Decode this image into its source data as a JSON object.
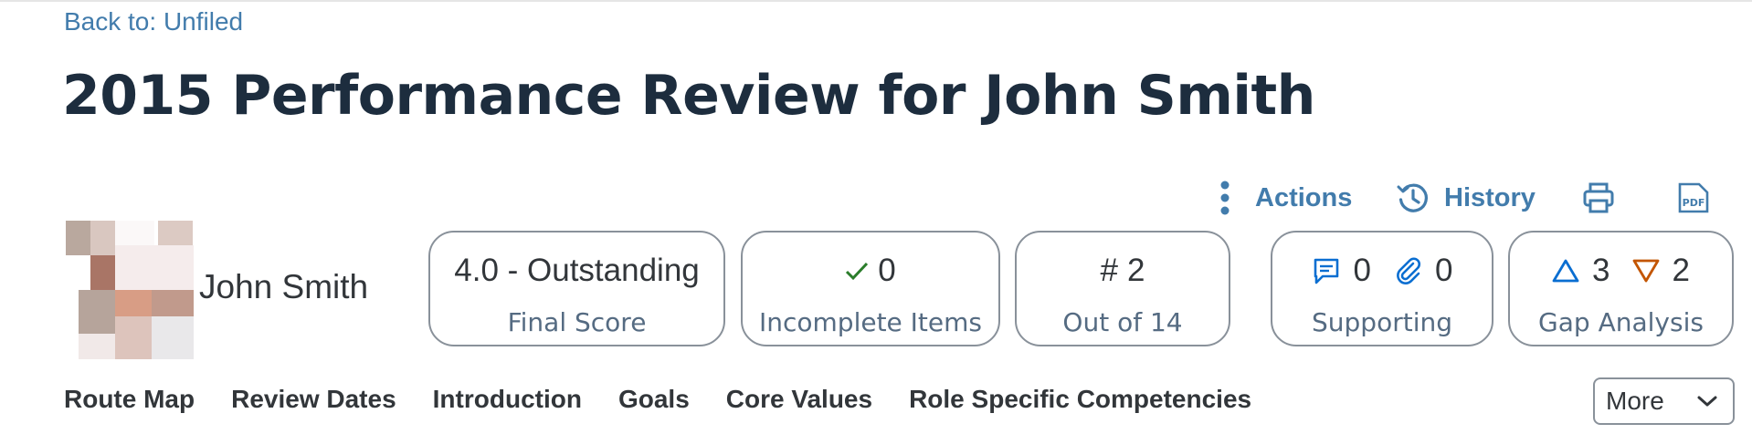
{
  "nav": {
    "back_link": "Back to: Unfiled"
  },
  "page": {
    "title": "2015 Performance Review for John Smith"
  },
  "actions": {
    "actions_label": "Actions",
    "history_label": "History",
    "print_icon": "printer-icon",
    "pdf_icon": "pdf-icon"
  },
  "user": {
    "name": "John Smith"
  },
  "cards": {
    "final_score": {
      "value": "4.0 - Outstanding",
      "label": "Final Score"
    },
    "incomplete": {
      "value": "0",
      "label": "Incomplete Items"
    },
    "rank": {
      "prefix": "#",
      "value": "2",
      "label": "Out of 14"
    },
    "supporting": {
      "comments": "0",
      "attachments": "0",
      "label": "Supporting"
    },
    "gap": {
      "up": "3",
      "down": "2",
      "label": "Gap Analysis"
    }
  },
  "tabs": [
    "Route Map",
    "Review Dates",
    "Introduction",
    "Goals",
    "Core Values",
    "Role Specific Competencies"
  ],
  "more": {
    "label": "More"
  },
  "colors": {
    "link": "#427cac",
    "title": "#1d2d3e",
    "check": "#2b7d2b",
    "gap_up": "#0a6ed1",
    "gap_down": "#c35500"
  }
}
